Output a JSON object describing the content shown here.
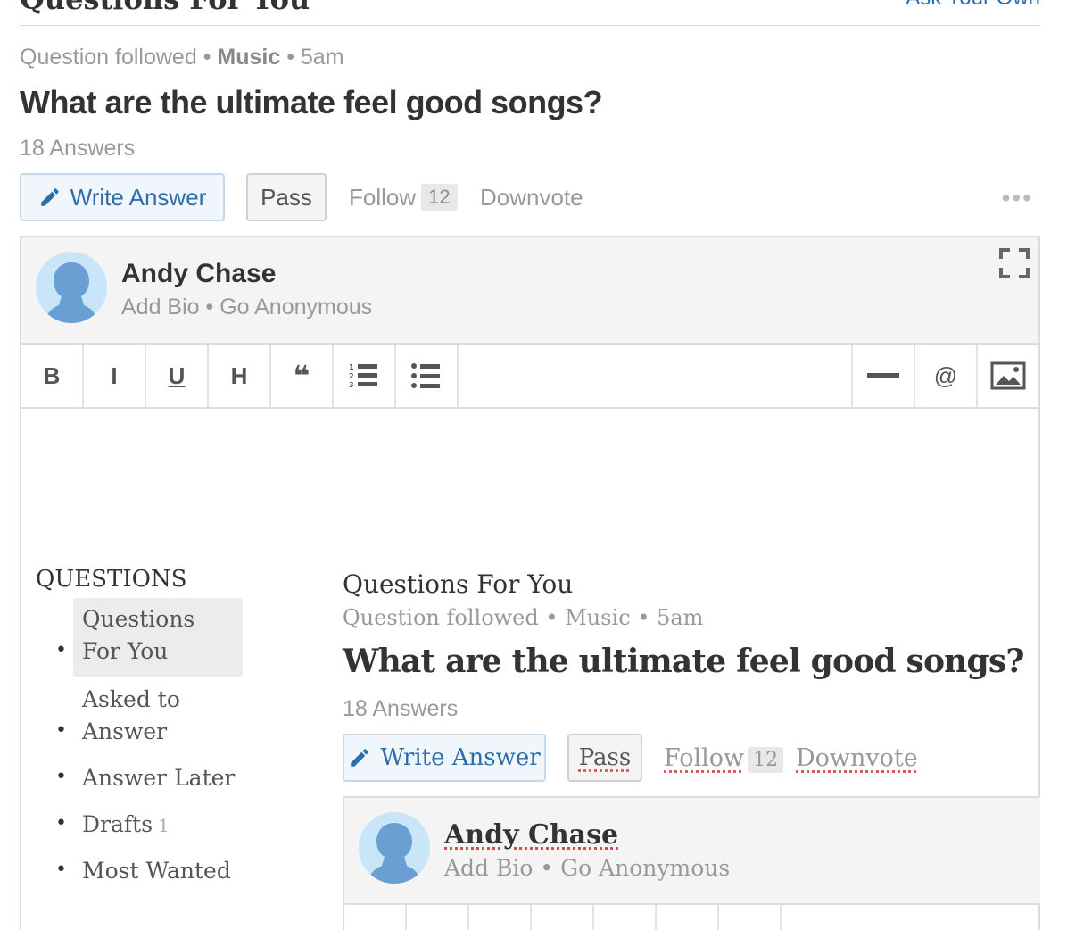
{
  "header": {
    "title": "Questions For You",
    "ask_link": "Ask Your Own"
  },
  "feed_item": {
    "meta_prefix": "Question followed",
    "topic": "Music",
    "time": "5am",
    "question": "What are the ultimate feel good songs?",
    "answers_count": "18 Answers",
    "write_answer": "Write Answer",
    "pass": "Pass",
    "follow": "Follow",
    "follow_count": "12",
    "downvote": "Downvote",
    "more": "•••"
  },
  "editor": {
    "author": "Andy Chase",
    "add_bio": "Add Bio",
    "go_anonymous": "Go Anonymous",
    "toolbar": {
      "bold": "B",
      "italic": "I",
      "underline": "U",
      "heading": "H",
      "quote": "❝",
      "at": "@"
    }
  },
  "preview": {
    "sidebar": {
      "heading": "QUESTIONS",
      "items": [
        {
          "label": "Questions For You",
          "active": true
        },
        {
          "label": "Asked to Answer"
        },
        {
          "label": "Answer Later"
        },
        {
          "label": "Drafts",
          "count": "1"
        },
        {
          "label": "Most Wanted"
        }
      ]
    },
    "title": "Questions For You",
    "meta_prefix": "Question followed",
    "topic": "Music",
    "time": "5am",
    "question": "What are the ultimate feel good songs?",
    "answers_count": "18 Answers",
    "write_answer": "Write Answer",
    "pass": "Pass",
    "follow": "Follow",
    "follow_count": "12",
    "downvote": "Downvote",
    "author": "Andy Chase",
    "add_bio": "Add Bio",
    "go_anonymous": "Go Anonymous"
  },
  "colors": {
    "link_blue": "#2b6dad",
    "muted_gray": "#999999",
    "panel_gray": "#f4f4f4"
  }
}
